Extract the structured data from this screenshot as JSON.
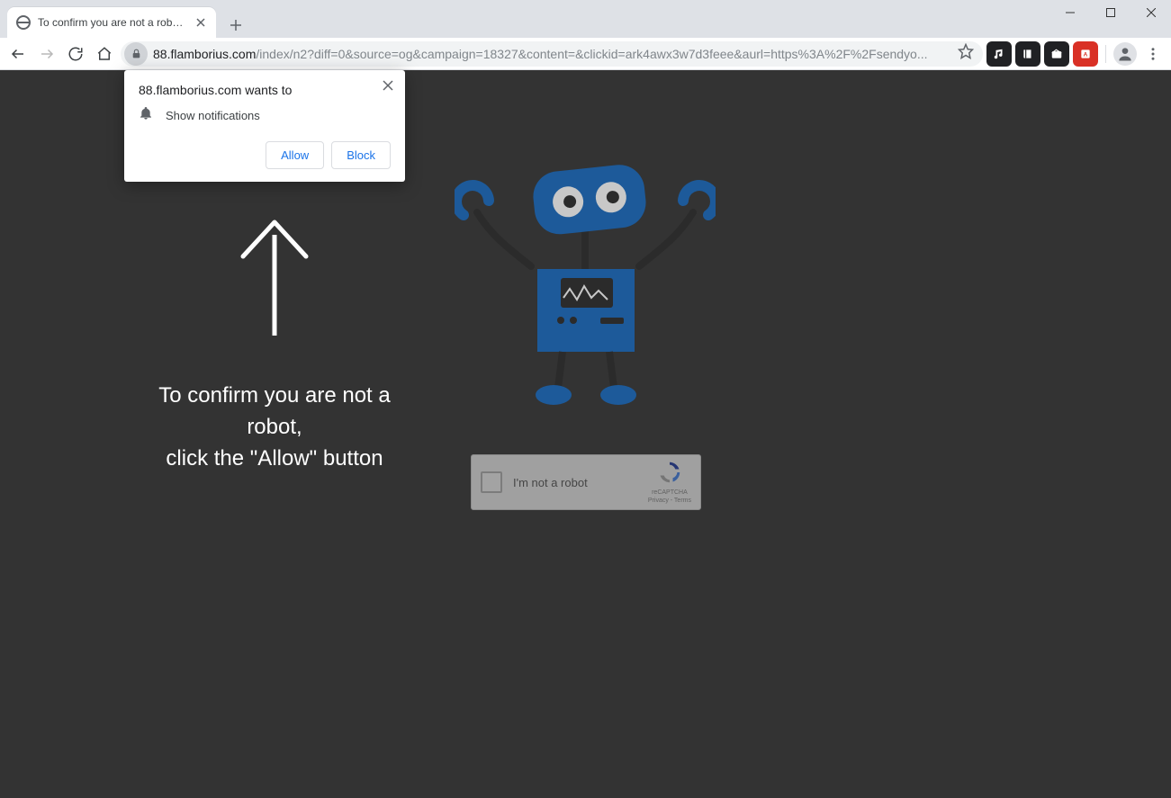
{
  "window": {
    "minimize": "–",
    "maximize": "▢",
    "close": "✕"
  },
  "tab": {
    "title": "To confirm you are not a robot, c"
  },
  "url": {
    "host": "88.flamborius.com",
    "path": "/index/n2?diff=0&source=og&campaign=18327&content=&clickid=ark4awx3w7d3feee&aurl=https%3A%2F%2Fsendyo..."
  },
  "prompt": {
    "title": "88.flamborius.com wants to",
    "permission": "Show notifications",
    "allow": "Allow",
    "block": "Block"
  },
  "page": {
    "message_line1": "To confirm you are not a robot,",
    "message_line2": "click the \"Allow\" button",
    "recaptcha_label": "I'm not a robot",
    "recaptcha_brand": "reCAPTCHA",
    "recaptcha_terms": "Privacy - Terms"
  }
}
